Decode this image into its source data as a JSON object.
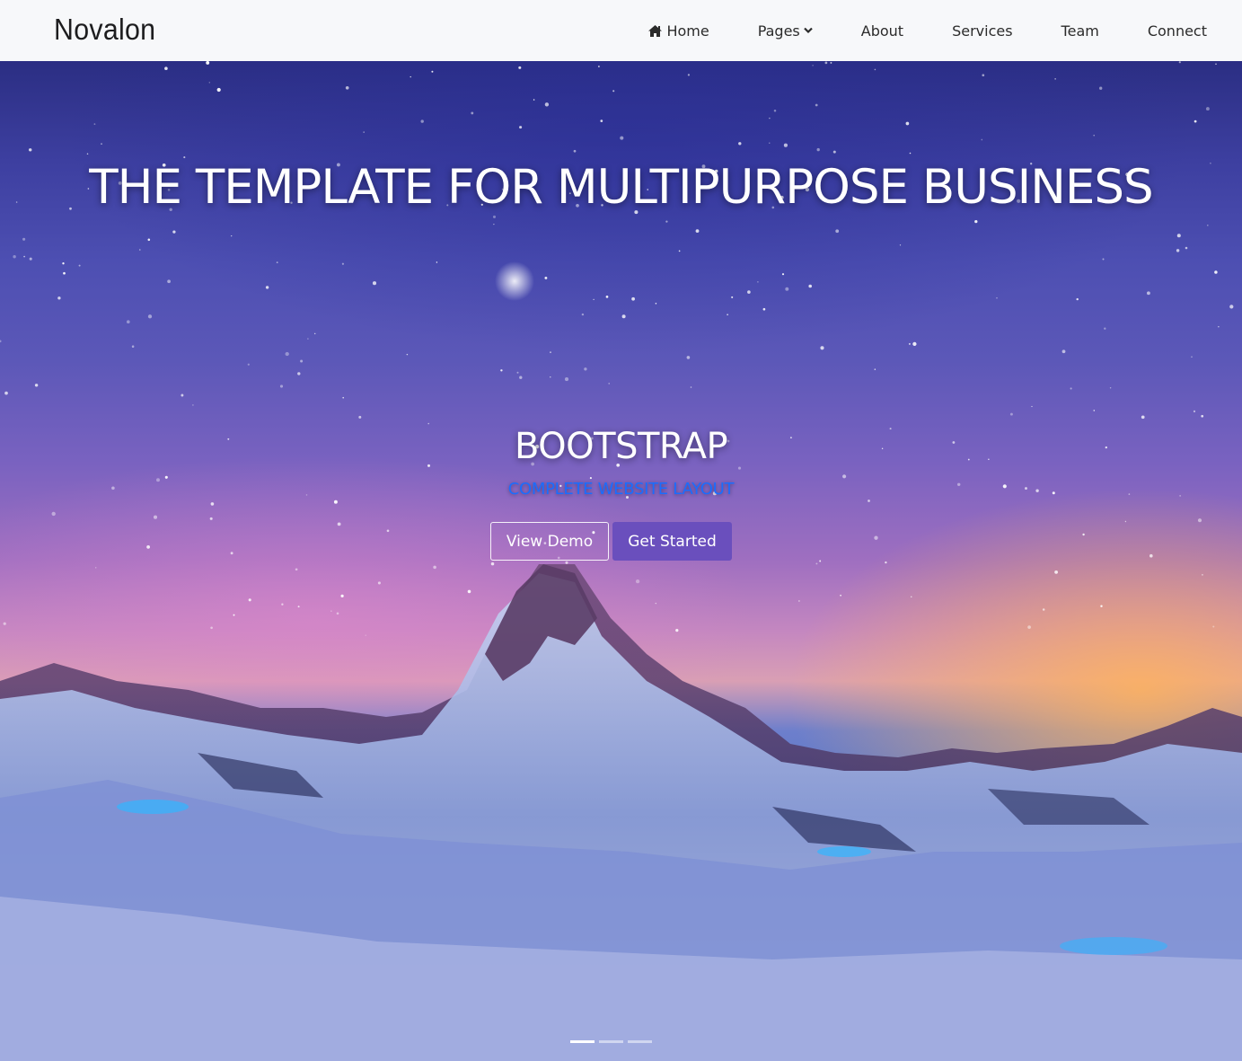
{
  "brand": {
    "name": "Novalon"
  },
  "nav": {
    "items": [
      {
        "label": "Home",
        "icon": "home-icon"
      },
      {
        "label": "Pages",
        "icon": "chevron-down-icon"
      },
      {
        "label": "About"
      },
      {
        "label": "Services"
      },
      {
        "label": "Team"
      },
      {
        "label": "Connect"
      }
    ]
  },
  "hero": {
    "title": "THE TEMPLATE FOR MULTIPURPOSE BUSINESS",
    "subtitle": "BOOTSTRAP",
    "tagline": "COMPLETE WEBSITE LAYOUT",
    "buttons": {
      "view_demo": "View Demo",
      "get_started": "Get Started"
    },
    "carousel": {
      "slide_count": 3,
      "active_index": 0
    }
  },
  "colors": {
    "primary_button": "#6a4fbd",
    "tagline": "#1a6dff",
    "navbar_bg": "#f7f8fa"
  }
}
